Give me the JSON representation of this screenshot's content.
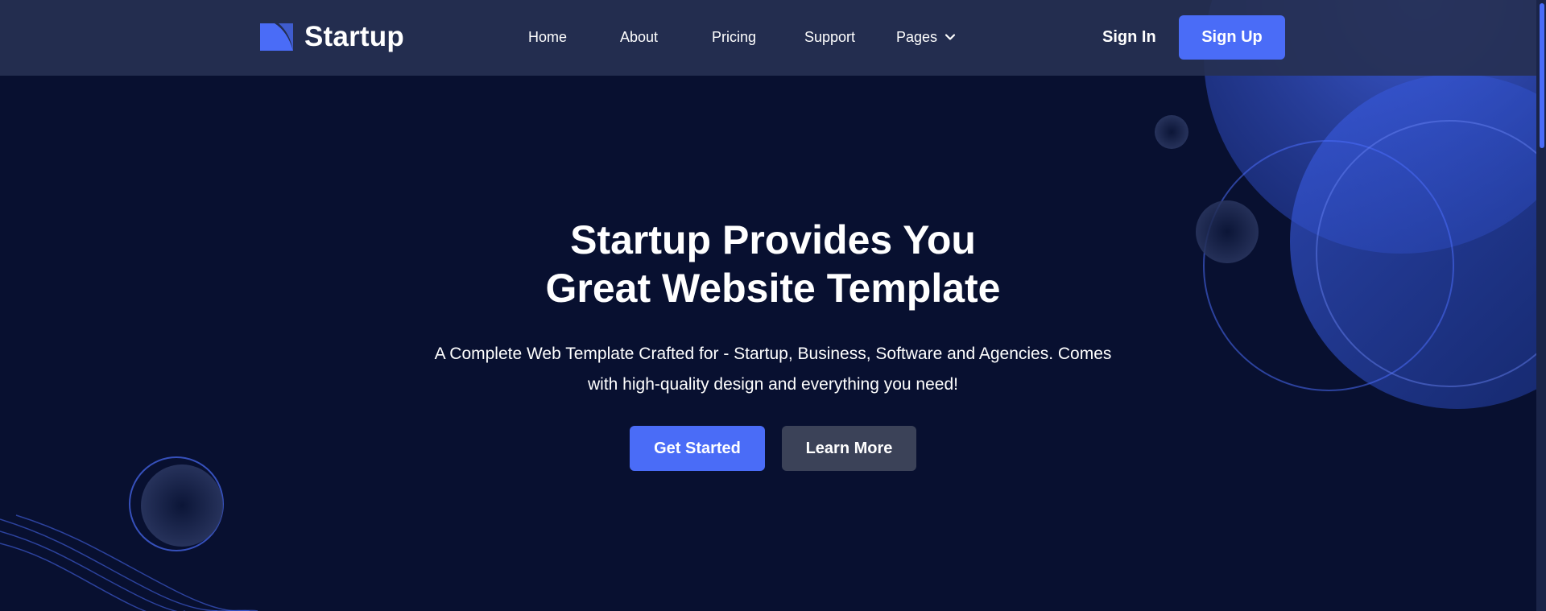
{
  "brand": {
    "name": "Startup",
    "accent_color": "#4a6cf7",
    "background_color": "#081030"
  },
  "nav": {
    "items": [
      {
        "label": "Home"
      },
      {
        "label": "About"
      },
      {
        "label": "Pricing"
      },
      {
        "label": "Support"
      },
      {
        "label": "Pages",
        "icon": "chevron-down-icon"
      }
    ]
  },
  "auth": {
    "sign_in": "Sign In",
    "sign_up": "Sign Up"
  },
  "hero": {
    "title_line1": "Startup Provides You",
    "title_line2": "Great Website Template",
    "subtitle_line1": "A Complete Web Template Crafted for - Startup, Business, Software and Agencies. Comes",
    "subtitle_line2": "with high-quality design and everything you need!",
    "primary_cta": "Get Started",
    "secondary_cta": "Learn More"
  }
}
